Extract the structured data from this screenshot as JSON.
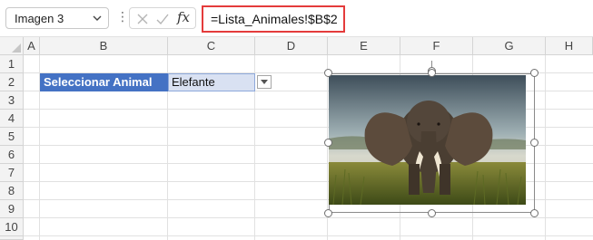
{
  "formula_bar": {
    "name_box": "Imagen 3",
    "more_glyph": "⋮",
    "fx_label": "fx",
    "formula": "=Lista_Animales!$B$2"
  },
  "grid": {
    "columns": [
      "A",
      "B",
      "C",
      "D",
      "E",
      "F",
      "G",
      "H"
    ],
    "rows": [
      "1",
      "2",
      "3",
      "4",
      "5",
      "6",
      "7",
      "8",
      "9",
      "10",
      "11"
    ]
  },
  "cells": {
    "B2": "Seleccionar Animal",
    "C2": "Elefante"
  },
  "colors": {
    "header_fill": "#4472c4",
    "selected_cell_fill": "#d9e1f2",
    "formula_highlight": "#e43b3b"
  },
  "picture": {
    "name": "Imagen 3",
    "subject": "elephant photo"
  }
}
